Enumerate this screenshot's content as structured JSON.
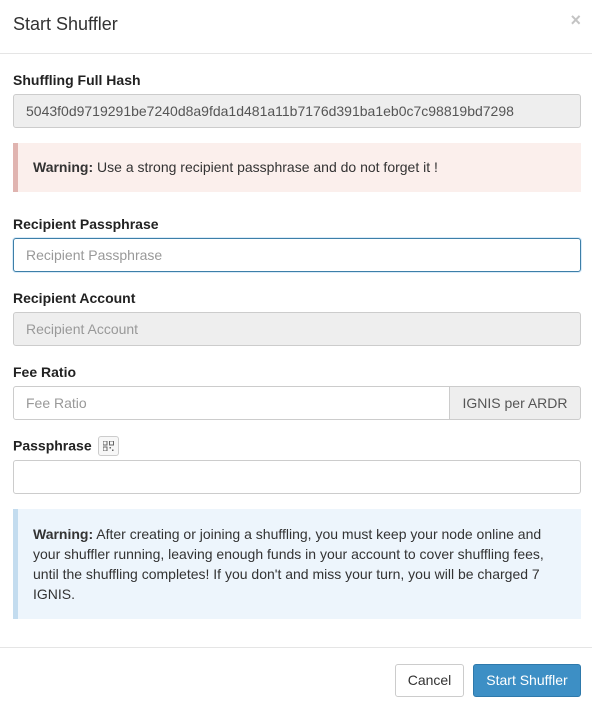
{
  "modal": {
    "title": "Start Shuffler",
    "close_glyph": "×"
  },
  "shuffling_hash": {
    "label": "Shuffling Full Hash",
    "value": "5043f0d9719291be7240d8a9fda1d481a11b7176d391ba1eb0c7c98819bd7298"
  },
  "warning_top": {
    "strong": "Warning:",
    "text": " Use a strong recipient passphrase and do not forget it !"
  },
  "recipient_passphrase": {
    "label": "Recipient Passphrase",
    "placeholder": "Recipient Passphrase"
  },
  "recipient_account": {
    "label": "Recipient Account",
    "placeholder": "Recipient Account"
  },
  "fee_ratio": {
    "label": "Fee Ratio",
    "placeholder": "Fee Ratio",
    "addon": "IGNIS per ARDR"
  },
  "passphrase": {
    "label": "Passphrase",
    "icon": "qr-code-icon",
    "value": ""
  },
  "warning_bottom": {
    "strong": "Warning:",
    "text": " After creating or joining a shuffling, you must keep your node online and your shuffler running, leaving enough funds in your account to cover shuffling fees, until the shuffling completes! If you don't and miss your turn, you will be charged 7 IGNIS."
  },
  "footer": {
    "cancel_label": "Cancel",
    "submit_label": "Start Shuffler"
  },
  "colors": {
    "primary": "#3d8fc5",
    "danger_bg": "#fbefec",
    "info_bg": "#edf5fc",
    "focus_border": "#66afe9"
  }
}
